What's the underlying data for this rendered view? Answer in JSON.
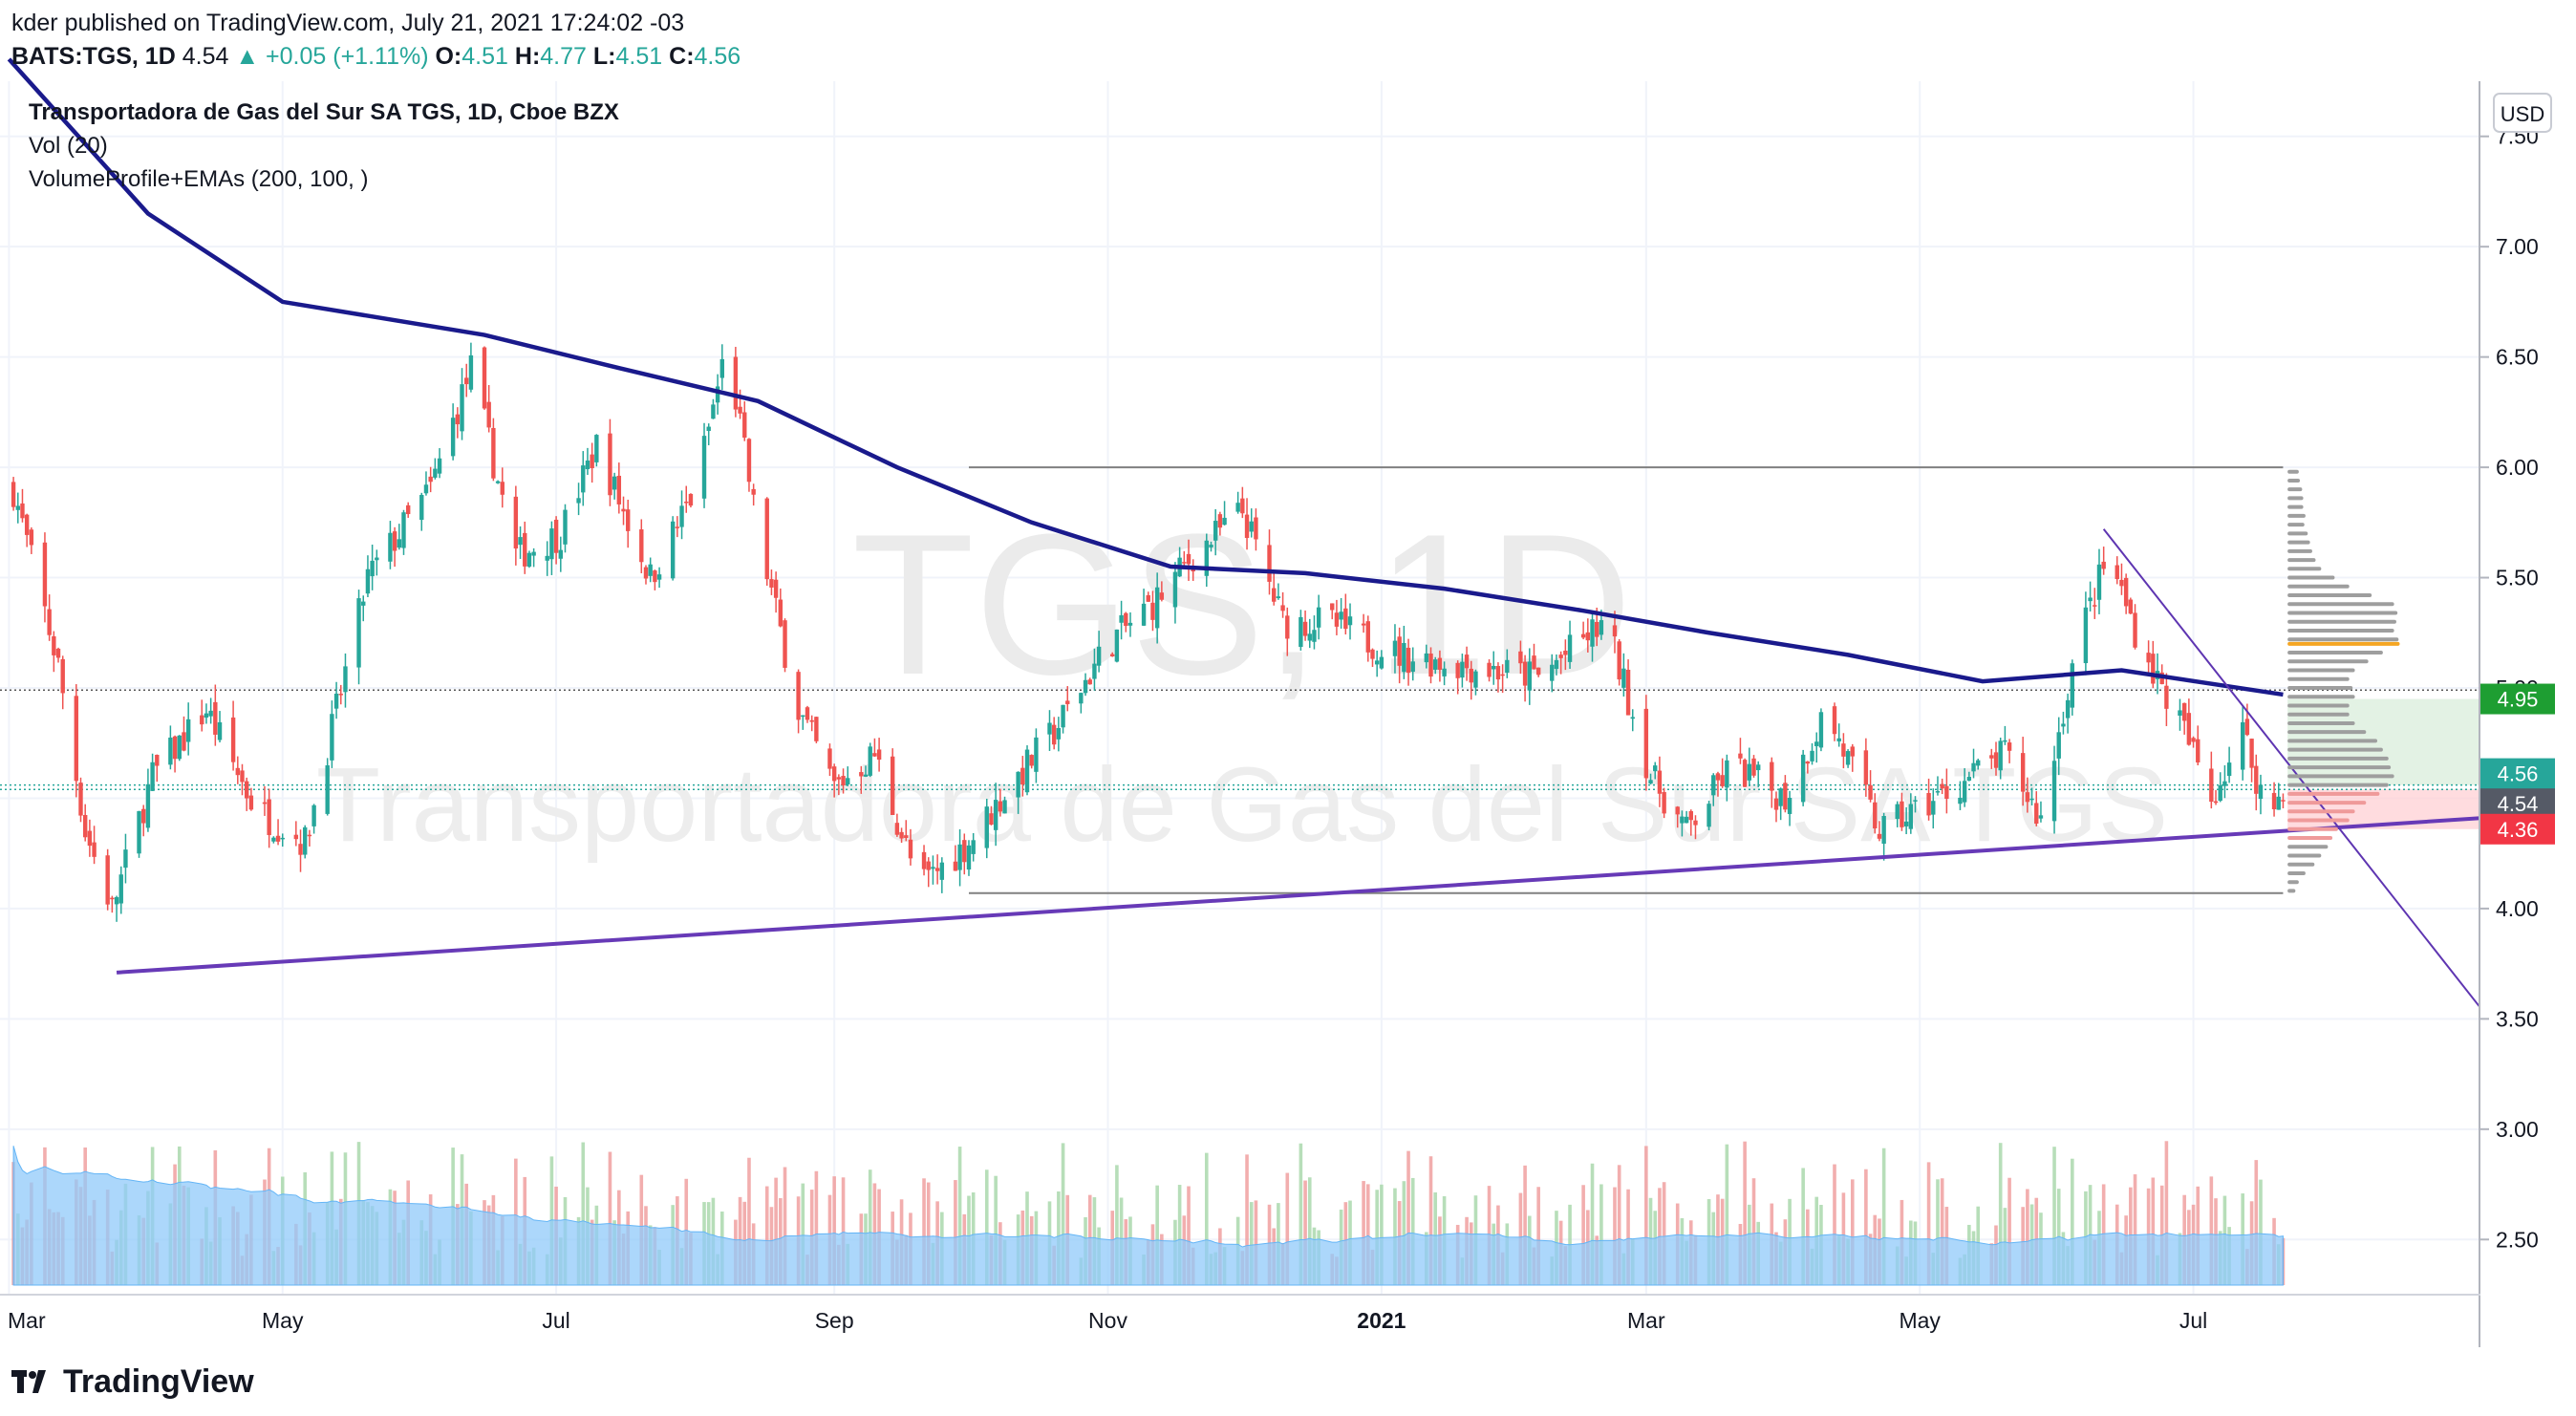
{
  "header": {
    "publisher_line": "kder published on TradingView.com, July 21, 2021 17:24:02 -03",
    "symbol": "BATS:TGS, 1D",
    "last": "4.54",
    "change": "+0.05 (+1.11%)",
    "open_label": "O:",
    "open": "4.51",
    "high_label": "H:",
    "high": "4.77",
    "low_label": "L:",
    "low": "4.51",
    "close_label": "C:",
    "close": "4.56"
  },
  "legend": {
    "title": "Transportadora de Gas del Sur SA TGS, 1D, Cboe BZX",
    "vol": "Vol (20)",
    "indicator": "VolumeProfile+EMAs (200, 100, )"
  },
  "watermark": {
    "big": "TGS, 1D",
    "small": "Transportadora de Gas del Sur SA TGS"
  },
  "footer": {
    "brand": "TradingView"
  },
  "colors": {
    "up": "#26a69a",
    "down": "#ef5350",
    "ema": "#1a1a8c",
    "trend": "#673ab7",
    "vol_ma": "#90caf9",
    "profile": "#9e9e9e",
    "poc": "#f5a623"
  },
  "chart_data": {
    "type": "candlestick",
    "currency": "USD",
    "y_ticks": [
      7.5,
      7.0,
      6.5,
      6.0,
      5.5,
      5.0,
      4.5,
      4.0,
      3.5,
      3.0,
      2.5
    ],
    "y_tick_labels": [
      "7.50",
      "7.00",
      "6.50",
      "6.00",
      "5.50",
      "5.00",
      "4.50",
      "4.00",
      "3.50",
      "3.00",
      "2.50"
    ],
    "ylim": [
      2.25,
      7.75
    ],
    "x_ticks": [
      "Mar",
      "May",
      "Jul",
      "Sep",
      "Nov",
      "2021",
      "Mar",
      "May",
      "Jul"
    ],
    "x_tick_dates": [
      "2020-03-01",
      "2020-05-01",
      "2020-07-01",
      "2020-09-01",
      "2020-11-01",
      "2021-01-01",
      "2021-03-01",
      "2021-05-01",
      "2021-07-01"
    ],
    "xlim": [
      "2020-02-28",
      "2021-09-03"
    ],
    "last_date": "2021-07-21",
    "price_tags": [
      {
        "value": 4.95,
        "label": "4.95",
        "color": "#1e9e32"
      },
      {
        "value": 4.56,
        "label": "4.56",
        "color": "#26a69a"
      },
      {
        "value": 4.54,
        "label": "4.54",
        "color": "#555a66"
      },
      {
        "value": 4.36,
        "label": "4.36",
        "color": "#f23645"
      }
    ],
    "anchors": [
      [
        "2020-03-02",
        5.9
      ],
      [
        "2020-03-12",
        5.1
      ],
      [
        "2020-03-18",
        4.35
      ],
      [
        "2020-03-24",
        4.0
      ],
      [
        "2020-04-02",
        4.6
      ],
      [
        "2020-04-14",
        4.9
      ],
      [
        "2020-04-25",
        4.45
      ],
      [
        "2020-05-06",
        4.3
      ],
      [
        "2020-05-20",
        5.5
      ],
      [
        "2020-06-03",
        5.9
      ],
      [
        "2020-06-12",
        6.45
      ],
      [
        "2020-06-22",
        5.6
      ],
      [
        "2020-07-02",
        5.7
      ],
      [
        "2020-07-10",
        6.1
      ],
      [
        "2020-07-22",
        5.5
      ],
      [
        "2020-08-01",
        5.9
      ],
      [
        "2020-08-08",
        6.55
      ],
      [
        "2020-08-15",
        5.7
      ],
      [
        "2020-08-24",
        4.9
      ],
      [
        "2020-09-01",
        4.55
      ],
      [
        "2020-09-10",
        4.7
      ],
      [
        "2020-09-20",
        4.1
      ],
      [
        "2020-10-01",
        4.3
      ],
      [
        "2020-10-10",
        4.55
      ],
      [
        "2020-10-20",
        4.8
      ],
      [
        "2020-11-01",
        5.2
      ],
      [
        "2020-11-12",
        5.4
      ],
      [
        "2020-11-20",
        5.6
      ],
      [
        "2020-12-01",
        5.8
      ],
      [
        "2020-12-10",
        5.3
      ],
      [
        "2020-12-20",
        5.3
      ],
      [
        "2021-01-05",
        5.15
      ],
      [
        "2021-01-20",
        5.1
      ],
      [
        "2021-02-05",
        5.05
      ],
      [
        "2021-02-20",
        5.3
      ],
      [
        "2021-03-02",
        4.6
      ],
      [
        "2021-03-10",
        4.35
      ],
      [
        "2021-03-20",
        4.65
      ],
      [
        "2021-04-01",
        4.5
      ],
      [
        "2021-04-10",
        4.9
      ],
      [
        "2021-04-22",
        4.35
      ],
      [
        "2021-05-05",
        4.5
      ],
      [
        "2021-05-20",
        4.7
      ],
      [
        "2021-05-28",
        4.4
      ],
      [
        "2021-06-05",
        5.2
      ],
      [
        "2021-06-12",
        5.6
      ],
      [
        "2021-06-20",
        5.15
      ],
      [
        "2021-06-28",
        4.85
      ],
      [
        "2021-07-05",
        4.5
      ],
      [
        "2021-07-12",
        4.8
      ],
      [
        "2021-07-18",
        4.4
      ],
      [
        "2021-07-21",
        4.56
      ]
    ],
    "ema200": [
      [
        "2020-03-01",
        7.85
      ],
      [
        "2020-04-01",
        7.15
      ],
      [
        "2020-05-01",
        6.75
      ],
      [
        "2020-06-15",
        6.6
      ],
      [
        "2020-07-15",
        6.45
      ],
      [
        "2020-08-15",
        6.3
      ],
      [
        "2020-09-15",
        6.0
      ],
      [
        "2020-10-15",
        5.75
      ],
      [
        "2020-11-15",
        5.55
      ],
      [
        "2020-12-15",
        5.52
      ],
      [
        "2021-01-15",
        5.45
      ],
      [
        "2021-02-15",
        5.35
      ],
      [
        "2021-03-15",
        5.25
      ],
      [
        "2021-04-15",
        5.15
      ],
      [
        "2021-05-15",
        5.03
      ],
      [
        "2021-06-15",
        5.08
      ],
      [
        "2021-07-21",
        4.97
      ]
    ],
    "lines": [
      {
        "name": "",
        "from": [
          "2020-10-01",
          6.0
        ],
        "to": [
          "2021-07-21",
          6.0
        ],
        "color": "#808080",
        "width": 2
      },
      {
        "name": "",
        "from": [
          "2020-10-01",
          4.07
        ],
        "to": [
          "2021-07-21",
          4.07
        ],
        "color": "#808080",
        "width": 2
      },
      {
        "name": "",
        "from": [
          "2020-03-25",
          3.71
        ],
        "to": [
          "2021-09-03",
          4.41
        ],
        "color": "#673ab7",
        "width": 4
      },
      {
        "name": "",
        "from": [
          "2021-06-11",
          5.72
        ],
        "to": [
          "2021-09-03",
          3.55
        ],
        "color": "#5e35b1",
        "width": 2
      }
    ],
    "dotted_levels": [
      4.99,
      4.56,
      4.54
    ],
    "volume_profile": {
      "start_date": "2021-07-22",
      "max_width_days": 25,
      "poc_price": 5.2,
      "rows": [
        [
          5.98,
          0.1
        ],
        [
          5.94,
          0.11
        ],
        [
          5.9,
          0.13
        ],
        [
          5.86,
          0.14
        ],
        [
          5.82,
          0.14
        ],
        [
          5.78,
          0.16
        ],
        [
          5.74,
          0.15
        ],
        [
          5.7,
          0.18
        ],
        [
          5.66,
          0.2
        ],
        [
          5.62,
          0.22
        ],
        [
          5.58,
          0.25
        ],
        [
          5.54,
          0.3
        ],
        [
          5.5,
          0.42
        ],
        [
          5.46,
          0.55
        ],
        [
          5.42,
          0.75
        ],
        [
          5.38,
          0.95
        ],
        [
          5.34,
          0.98
        ],
        [
          5.3,
          0.97
        ],
        [
          5.26,
          0.95
        ],
        [
          5.22,
          0.99
        ],
        [
          5.2,
          1.0
        ],
        [
          5.16,
          0.85
        ],
        [
          5.12,
          0.72
        ],
        [
          5.08,
          0.6
        ],
        [
          5.04,
          0.55
        ],
        [
          5.0,
          0.58
        ],
        [
          4.96,
          0.6
        ],
        [
          4.92,
          0.55
        ],
        [
          4.88,
          0.55
        ],
        [
          4.84,
          0.6
        ],
        [
          4.8,
          0.7
        ],
        [
          4.76,
          0.8
        ],
        [
          4.72,
          0.85
        ],
        [
          4.68,
          0.9
        ],
        [
          4.64,
          0.92
        ],
        [
          4.6,
          0.95
        ],
        [
          4.56,
          0.9
        ],
        [
          4.52,
          0.82
        ],
        [
          4.48,
          0.7
        ],
        [
          4.44,
          0.6
        ],
        [
          4.4,
          0.55
        ],
        [
          4.36,
          0.45
        ],
        [
          4.32,
          0.4
        ],
        [
          4.28,
          0.36
        ],
        [
          4.24,
          0.3
        ],
        [
          4.2,
          0.24
        ],
        [
          4.16,
          0.16
        ],
        [
          4.12,
          0.1
        ],
        [
          4.08,
          0.07
        ]
      ]
    },
    "value_area": {
      "from_date": "2021-07-22",
      "to_date": "2021-09-03",
      "up_from": 4.56,
      "up_to": 4.95,
      "down_from": 4.36,
      "down_to": 4.54
    }
  }
}
